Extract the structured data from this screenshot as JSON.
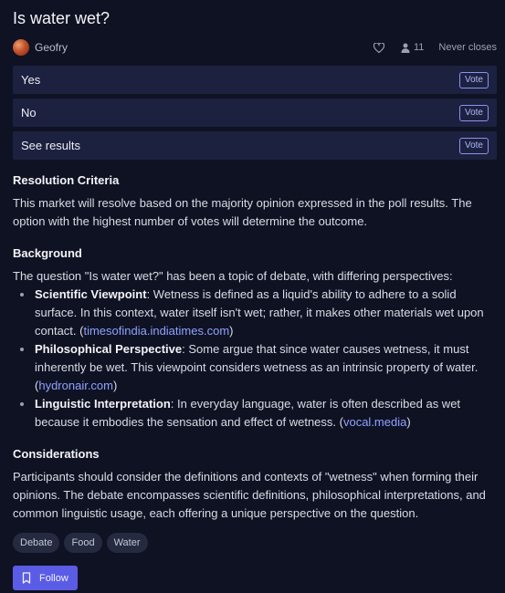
{
  "market": {
    "title": "Is water wet?",
    "author": "Geofry",
    "trader_count": "11",
    "close_text": "Never closes"
  },
  "options": [
    {
      "label": "Yes",
      "action": "Vote"
    },
    {
      "label": "No",
      "action": "Vote"
    },
    {
      "label": "See results",
      "action": "Vote"
    }
  ],
  "resolution": {
    "heading": "Resolution Criteria",
    "text": "This market will resolve based on the majority opinion expressed in the poll results. The option with the highest number of votes will determine the outcome."
  },
  "background": {
    "heading": "Background",
    "intro": "The question \"Is water wet?\" has been a topic of debate, with differing perspectives:",
    "items": [
      {
        "label": "Scientific Viewpoint",
        "text": ": Wetness is defined as a liquid's ability to adhere to a solid surface. In this context, water itself isn't wet; rather, it makes other materials wet upon contact. (",
        "link": "timesofindia.indiatimes.com",
        "after": ")"
      },
      {
        "label": "Philosophical Perspective",
        "text": ": Some argue that since water causes wetness, it must inherently be wet. This viewpoint considers wetness as an intrinsic property of water. (",
        "link": "hydronair.com",
        "after": ")"
      },
      {
        "label": "Linguistic Interpretation",
        "text": ": In everyday language, water is often described as wet because it embodies the sensation and effect of wetness. (",
        "link": "vocal.media",
        "after": ")"
      }
    ]
  },
  "considerations": {
    "heading": "Considerations",
    "text": "Participants should consider the definitions and contexts of \"wetness\" when forming their opinions. The debate encompasses scientific definitions, philosophical interpretations, and common linguistic usage, each offering a unique perspective on the question."
  },
  "tags": [
    "Debate",
    "Food",
    "Water"
  ],
  "follow_label": "Follow",
  "colors": {
    "background": "#0f1223",
    "option_bg": "#1c2140",
    "accent": "#5b5ce6",
    "link": "#8fa2ff"
  }
}
